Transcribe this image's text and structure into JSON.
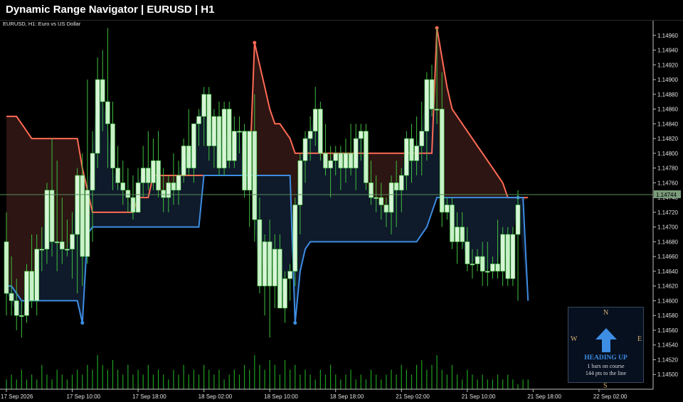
{
  "window": {
    "title": "Dynamic Range Navigator  |  EURUSD  |  H1"
  },
  "chart_header": {
    "symbol_label": "EURUSD, H1:  Euro vs US Dollar"
  },
  "colors": {
    "background": "#000000",
    "bull_candle": "#d8f5d8",
    "bear_candle": "#c8f0c8",
    "wick": "#3fbf3f",
    "volume": "#1fa01f",
    "upper_line": "#ff6a55",
    "lower_line": "#3d8de3",
    "upper_fill": "#2c1512",
    "lower_fill": "#0f1a2a",
    "price_line": "#5a8f5a"
  },
  "chart_data": {
    "type": "candlestick",
    "symbol": "EURUSD",
    "timeframe": "H1",
    "ylim": [
      1.1448,
      1.1498
    ],
    "y_ticks": [
      1.145,
      1.1452,
      1.1454,
      1.1456,
      1.1458,
      1.146,
      1.1462,
      1.1464,
      1.1466,
      1.1468,
      1.147,
      1.1472,
      1.1474,
      1.1476,
      1.1478,
      1.148,
      1.1482,
      1.1484,
      1.1486,
      1.1488,
      1.149,
      1.1492,
      1.1494,
      1.1496
    ],
    "y_tick_labels": [
      "1.14500",
      "1.14520",
      "1.14540",
      "1.14560",
      "1.14580",
      "1.14600",
      "1.14620",
      "1.14640",
      "1.14660",
      "1.14680",
      "1.14700",
      "1.14720",
      "1.14740",
      "1.14760",
      "1.14780",
      "1.14800",
      "1.14820",
      "1.14840",
      "1.14860",
      "1.14880",
      "1.14900",
      "1.14920",
      "1.14940",
      "1.14960"
    ],
    "x_labels": [
      "17 Sep 2026",
      "17 Sep 10:00",
      "17 Sep 18:00",
      "18 Sep 02:00",
      "18 Sep 10:00",
      "18 Sep 18:00",
      "21 Sep 02:00",
      "21 Sep 10:00",
      "21 Sep 18:00",
      "22 Sep 02:00"
    ],
    "x_label_bars": [
      0,
      13,
      26,
      39,
      52,
      65,
      78,
      91,
      104,
      117
    ],
    "current_price": 1.14744,
    "current_price_label": "1.14744",
    "candles": [
      {
        "o": 1.1468,
        "h": 1.1472,
        "l": 1.1458,
        "c": 1.1461
      },
      {
        "o": 1.1461,
        "h": 1.1466,
        "l": 1.1458,
        "c": 1.146
      },
      {
        "o": 1.146,
        "h": 1.1463,
        "l": 1.1456,
        "c": 1.1458
      },
      {
        "o": 1.1458,
        "h": 1.146,
        "l": 1.1455,
        "c": 1.1458
      },
      {
        "o": 1.1458,
        "h": 1.1465,
        "l": 1.1457,
        "c": 1.1464
      },
      {
        "o": 1.1464,
        "h": 1.1469,
        "l": 1.1459,
        "c": 1.146
      },
      {
        "o": 1.146,
        "h": 1.1469,
        "l": 1.1458,
        "c": 1.1467
      },
      {
        "o": 1.1467,
        "h": 1.147,
        "l": 1.1464,
        "c": 1.1467
      },
      {
        "o": 1.1467,
        "h": 1.1476,
        "l": 1.1465,
        "c": 1.1475
      },
      {
        "o": 1.1475,
        "h": 1.1482,
        "l": 1.1466,
        "c": 1.1468
      },
      {
        "o": 1.1468,
        "h": 1.1479,
        "l": 1.1464,
        "c": 1.1468
      },
      {
        "o": 1.1468,
        "h": 1.1474,
        "l": 1.1465,
        "c": 1.1467
      },
      {
        "o": 1.1467,
        "h": 1.1471,
        "l": 1.1466,
        "c": 1.1467
      },
      {
        "o": 1.1467,
        "h": 1.1472,
        "l": 1.1463,
        "c": 1.1469
      },
      {
        "o": 1.1469,
        "h": 1.1478,
        "l": 1.1461,
        "c": 1.1477
      },
      {
        "o": 1.1477,
        "h": 1.148,
        "l": 1.1462,
        "c": 1.1466
      },
      {
        "o": 1.1466,
        "h": 1.149,
        "l": 1.1465,
        "c": 1.1475
      },
      {
        "o": 1.1475,
        "h": 1.1483,
        "l": 1.1468,
        "c": 1.148
      },
      {
        "o": 1.148,
        "h": 1.1493,
        "l": 1.1478,
        "c": 1.149
      },
      {
        "o": 1.149,
        "h": 1.1494,
        "l": 1.1483,
        "c": 1.1487
      },
      {
        "o": 1.1487,
        "h": 1.1497,
        "l": 1.1478,
        "c": 1.1484
      },
      {
        "o": 1.1484,
        "h": 1.1487,
        "l": 1.1475,
        "c": 1.1478
      },
      {
        "o": 1.1478,
        "h": 1.1481,
        "l": 1.1475,
        "c": 1.1476
      },
      {
        "o": 1.1476,
        "h": 1.1479,
        "l": 1.1473,
        "c": 1.1475
      },
      {
        "o": 1.1475,
        "h": 1.1478,
        "l": 1.1472,
        "c": 1.1474
      },
      {
        "o": 1.1474,
        "h": 1.1477,
        "l": 1.1471,
        "c": 1.1472
      },
      {
        "o": 1.1472,
        "h": 1.1478,
        "l": 1.1472,
        "c": 1.1476
      },
      {
        "o": 1.1476,
        "h": 1.1481,
        "l": 1.1474,
        "c": 1.1478
      },
      {
        "o": 1.1478,
        "h": 1.1483,
        "l": 1.1475,
        "c": 1.1476
      },
      {
        "o": 1.1476,
        "h": 1.1482,
        "l": 1.1475,
        "c": 1.1479
      },
      {
        "o": 1.1479,
        "h": 1.1483,
        "l": 1.1474,
        "c": 1.1475
      },
      {
        "o": 1.1475,
        "h": 1.1478,
        "l": 1.1472,
        "c": 1.1474
      },
      {
        "o": 1.1474,
        "h": 1.1477,
        "l": 1.1472,
        "c": 1.1476
      },
      {
        "o": 1.1476,
        "h": 1.148,
        "l": 1.1473,
        "c": 1.1475
      },
      {
        "o": 1.1475,
        "h": 1.1479,
        "l": 1.1473,
        "c": 1.1477
      },
      {
        "o": 1.1477,
        "h": 1.1482,
        "l": 1.1476,
        "c": 1.1481
      },
      {
        "o": 1.1481,
        "h": 1.1486,
        "l": 1.1477,
        "c": 1.1478
      },
      {
        "o": 1.1478,
        "h": 1.1484,
        "l": 1.1476,
        "c": 1.1484
      },
      {
        "o": 1.1484,
        "h": 1.1486,
        "l": 1.1481,
        "c": 1.1485
      },
      {
        "o": 1.1485,
        "h": 1.1489,
        "l": 1.1481,
        "c": 1.1488
      },
      {
        "o": 1.1488,
        "h": 1.1489,
        "l": 1.1479,
        "c": 1.1481
      },
      {
        "o": 1.1481,
        "h": 1.1486,
        "l": 1.1478,
        "c": 1.1485
      },
      {
        "o": 1.1485,
        "h": 1.1487,
        "l": 1.1477,
        "c": 1.1478
      },
      {
        "o": 1.1478,
        "h": 1.1487,
        "l": 1.1477,
        "c": 1.1486
      },
      {
        "o": 1.1486,
        "h": 1.1487,
        "l": 1.1478,
        "c": 1.1479
      },
      {
        "o": 1.1479,
        "h": 1.1485,
        "l": 1.1478,
        "c": 1.1483
      },
      {
        "o": 1.1483,
        "h": 1.1485,
        "l": 1.148,
        "c": 1.1483
      },
      {
        "o": 1.1483,
        "h": 1.1484,
        "l": 1.1474,
        "c": 1.1475
      },
      {
        "o": 1.1475,
        "h": 1.1483,
        "l": 1.147,
        "c": 1.1483
      },
      {
        "o": 1.1483,
        "h": 1.1488,
        "l": 1.1468,
        "c": 1.1471
      },
      {
        "o": 1.1471,
        "h": 1.1474,
        "l": 1.1461,
        "c": 1.1462
      },
      {
        "o": 1.1462,
        "h": 1.1469,
        "l": 1.1458,
        "c": 1.1468
      },
      {
        "o": 1.1468,
        "h": 1.1471,
        "l": 1.1455,
        "c": 1.1462
      },
      {
        "o": 1.1462,
        "h": 1.1469,
        "l": 1.1459,
        "c": 1.1467
      },
      {
        "o": 1.1467,
        "h": 1.1469,
        "l": 1.1459,
        "c": 1.1459
      },
      {
        "o": 1.1459,
        "h": 1.1464,
        "l": 1.1457,
        "c": 1.1463
      },
      {
        "o": 1.1463,
        "h": 1.1465,
        "l": 1.146,
        "c": 1.1464
      },
      {
        "o": 1.1464,
        "h": 1.1474,
        "l": 1.1462,
        "c": 1.1473
      },
      {
        "o": 1.1473,
        "h": 1.148,
        "l": 1.1469,
        "c": 1.1479
      },
      {
        "o": 1.1479,
        "h": 1.1483,
        "l": 1.1476,
        "c": 1.1482
      },
      {
        "o": 1.1482,
        "h": 1.1485,
        "l": 1.1479,
        "c": 1.1483
      },
      {
        "o": 1.1483,
        "h": 1.1489,
        "l": 1.1481,
        "c": 1.1486
      },
      {
        "o": 1.1486,
        "h": 1.1487,
        "l": 1.1479,
        "c": 1.148
      },
      {
        "o": 1.148,
        "h": 1.1484,
        "l": 1.1477,
        "c": 1.1478
      },
      {
        "o": 1.1478,
        "h": 1.1481,
        "l": 1.1474,
        "c": 1.1479
      },
      {
        "o": 1.1479,
        "h": 1.1481,
        "l": 1.1477,
        "c": 1.148
      },
      {
        "o": 1.148,
        "h": 1.1481,
        "l": 1.1475,
        "c": 1.1478
      },
      {
        "o": 1.1478,
        "h": 1.1482,
        "l": 1.1476,
        "c": 1.148
      },
      {
        "o": 1.148,
        "h": 1.1484,
        "l": 1.1477,
        "c": 1.1478
      },
      {
        "o": 1.1478,
        "h": 1.1484,
        "l": 1.1475,
        "c": 1.1482
      },
      {
        "o": 1.1482,
        "h": 1.1484,
        "l": 1.1479,
        "c": 1.1483
      },
      {
        "o": 1.1483,
        "h": 1.1484,
        "l": 1.1475,
        "c": 1.1476
      },
      {
        "o": 1.1476,
        "h": 1.1479,
        "l": 1.1473,
        "c": 1.1474
      },
      {
        "o": 1.1474,
        "h": 1.1477,
        "l": 1.1472,
        "c": 1.1474
      },
      {
        "o": 1.1474,
        "h": 1.1476,
        "l": 1.1471,
        "c": 1.1473
      },
      {
        "o": 1.1473,
        "h": 1.1474,
        "l": 1.147,
        "c": 1.1472
      },
      {
        "o": 1.1472,
        "h": 1.1477,
        "l": 1.1469,
        "c": 1.1476
      },
      {
        "o": 1.1476,
        "h": 1.1479,
        "l": 1.147,
        "c": 1.1475
      },
      {
        "o": 1.1475,
        "h": 1.1478,
        "l": 1.1472,
        "c": 1.1477
      },
      {
        "o": 1.1477,
        "h": 1.1483,
        "l": 1.1475,
        "c": 1.1482
      },
      {
        "o": 1.1482,
        "h": 1.1484,
        "l": 1.1476,
        "c": 1.1479
      },
      {
        "o": 1.1479,
        "h": 1.1485,
        "l": 1.1477,
        "c": 1.1481
      },
      {
        "o": 1.1481,
        "h": 1.1487,
        "l": 1.1477,
        "c": 1.1483
      },
      {
        "o": 1.1483,
        "h": 1.1491,
        "l": 1.1479,
        "c": 1.149
      },
      {
        "o": 1.149,
        "h": 1.1492,
        "l": 1.1485,
        "c": 1.1486
      },
      {
        "o": 1.1486,
        "h": 1.1497,
        "l": 1.1484,
        "c": 1.1486
      },
      {
        "o": 1.1486,
        "h": 1.1491,
        "l": 1.147,
        "c": 1.1472
      },
      {
        "o": 1.1472,
        "h": 1.1474,
        "l": 1.1471,
        "c": 1.1473
      },
      {
        "o": 1.1473,
        "h": 1.1474,
        "l": 1.1467,
        "c": 1.1468
      },
      {
        "o": 1.1468,
        "h": 1.1472,
        "l": 1.1465,
        "c": 1.147
      },
      {
        "o": 1.147,
        "h": 1.1472,
        "l": 1.1467,
        "c": 1.1468
      },
      {
        "o": 1.1468,
        "h": 1.147,
        "l": 1.1464,
        "c": 1.1465
      },
      {
        "o": 1.1465,
        "h": 1.1467,
        "l": 1.1463,
        "c": 1.1465
      },
      {
        "o": 1.1465,
        "h": 1.1467,
        "l": 1.1464,
        "c": 1.1466
      },
      {
        "o": 1.1466,
        "h": 1.1468,
        "l": 1.1462,
        "c": 1.1464
      },
      {
        "o": 1.1464,
        "h": 1.1468,
        "l": 1.1462,
        "c": 1.1464
      },
      {
        "o": 1.1464,
        "h": 1.1466,
        "l": 1.1463,
        "c": 1.1465
      },
      {
        "o": 1.1465,
        "h": 1.1471,
        "l": 1.1463,
        "c": 1.1464
      },
      {
        "o": 1.1464,
        "h": 1.147,
        "l": 1.1462,
        "c": 1.1469
      },
      {
        "o": 1.1469,
        "h": 1.147,
        "l": 1.1462,
        "c": 1.1463
      },
      {
        "o": 1.1463,
        "h": 1.147,
        "l": 1.1462,
        "c": 1.1469
      },
      {
        "o": 1.1469,
        "h": 1.1475,
        "l": 1.146,
        "c": 1.1473
      }
    ],
    "upper_band": [
      1.1485,
      1.1485,
      1.1485,
      1.1484,
      1.1483,
      1.1482,
      1.1482,
      1.1482,
      1.1482,
      1.1482,
      1.1482,
      1.1482,
      1.1482,
      1.1482,
      1.1482,
      1.1478,
      1.1475,
      1.1472,
      1.1472,
      1.1472,
      1.1472,
      1.1472,
      1.1472,
      1.1472,
      1.1472,
      1.1472,
      1.1474,
      1.1474,
      1.1474,
      1.1477,
      1.1477,
      1.1477,
      1.1477,
      1.1477,
      1.1477,
      1.1477,
      1.1477,
      1.1477,
      1.1477,
      1.1477,
      1.1477,
      1.1477,
      1.1477,
      1.1477,
      1.1477,
      1.1477,
      1.1477,
      1.1477,
      1.1477,
      1.1495,
      1.1492,
      1.1489,
      1.1486,
      1.1484,
      1.1484,
      1.1483,
      1.1482,
      1.148,
      1.148,
      1.148,
      1.148,
      1.148,
      1.148,
      1.148,
      1.148,
      1.148,
      1.148,
      1.148,
      1.148,
      1.148,
      1.148,
      1.148,
      1.148,
      1.148,
      1.148,
      1.148,
      1.148,
      1.148,
      1.148,
      1.148,
      1.148,
      1.148,
      1.148,
      1.148,
      1.148,
      1.1497,
      1.1493,
      1.1489,
      1.1486,
      1.1485,
      1.1484,
      1.1483,
      1.1482,
      1.1481,
      1.148,
      1.1479,
      1.1478,
      1.1477,
      1.1476,
      1.1474,
      1.1474,
      1.1474,
      1.1474,
      1.1474
    ],
    "lower_band": [
      1.1462,
      1.1462,
      1.1461,
      1.146,
      1.146,
      1.146,
      1.146,
      1.146,
      1.146,
      1.146,
      1.146,
      1.146,
      1.146,
      1.146,
      1.146,
      1.1457,
      1.1469,
      1.147,
      1.147,
      1.147,
      1.147,
      1.147,
      1.147,
      1.147,
      1.147,
      1.147,
      1.147,
      1.147,
      1.147,
      1.147,
      1.147,
      1.147,
      1.147,
      1.147,
      1.147,
      1.147,
      1.147,
      1.147,
      1.147,
      1.1477,
      1.1477,
      1.1477,
      1.1477,
      1.1477,
      1.1477,
      1.1477,
      1.1477,
      1.1477,
      1.1477,
      1.1477,
      1.1477,
      1.1477,
      1.1477,
      1.1477,
      1.1477,
      1.1477,
      1.1477,
      1.1457,
      1.1464,
      1.1467,
      1.1468,
      1.1468,
      1.1468,
      1.1468,
      1.1468,
      1.1468,
      1.1468,
      1.1468,
      1.1468,
      1.1468,
      1.1468,
      1.1468,
      1.1468,
      1.1468,
      1.1468,
      1.1468,
      1.1468,
      1.1468,
      1.1468,
      1.1468,
      1.1468,
      1.1468,
      1.1469,
      1.147,
      1.1472,
      1.1474,
      1.1474,
      1.1474,
      1.1474,
      1.1474,
      1.1474,
      1.1474,
      1.1474,
      1.1474,
      1.1474,
      1.1474,
      1.1474,
      1.1474,
      1.1474,
      1.1474,
      1.1474,
      1.1474,
      1.1474,
      1.146
    ],
    "volumes": [
      2,
      3,
      2,
      4,
      2,
      3,
      2,
      5,
      3,
      2,
      4,
      3,
      2,
      3,
      4,
      3,
      5,
      4,
      7,
      5,
      4,
      6,
      4,
      3,
      5,
      3,
      4,
      3,
      5,
      3,
      4,
      3,
      2,
      4,
      3,
      5,
      3,
      4,
      3,
      5,
      4,
      3,
      4,
      2,
      3,
      4,
      3,
      5,
      4,
      7,
      5,
      4,
      6,
      5,
      3,
      6,
      4,
      5,
      3,
      4,
      3,
      2,
      4,
      3,
      5,
      3,
      2,
      3,
      4,
      2,
      3,
      2,
      4,
      3,
      2,
      3,
      4,
      3,
      5,
      4,
      3,
      5,
      6,
      4,
      5,
      7,
      4,
      3,
      5,
      3,
      2,
      4,
      3,
      2,
      3,
      2,
      2,
      3,
      2,
      3,
      2,
      1,
      2,
      2
    ]
  },
  "compass": {
    "n": "N",
    "s": "S",
    "e": "E",
    "w": "W",
    "heading": "HEADING UP",
    "line1": "1 bars on course",
    "line2": "144 pts to the line",
    "arrow_icon": "arrow-up-icon"
  }
}
